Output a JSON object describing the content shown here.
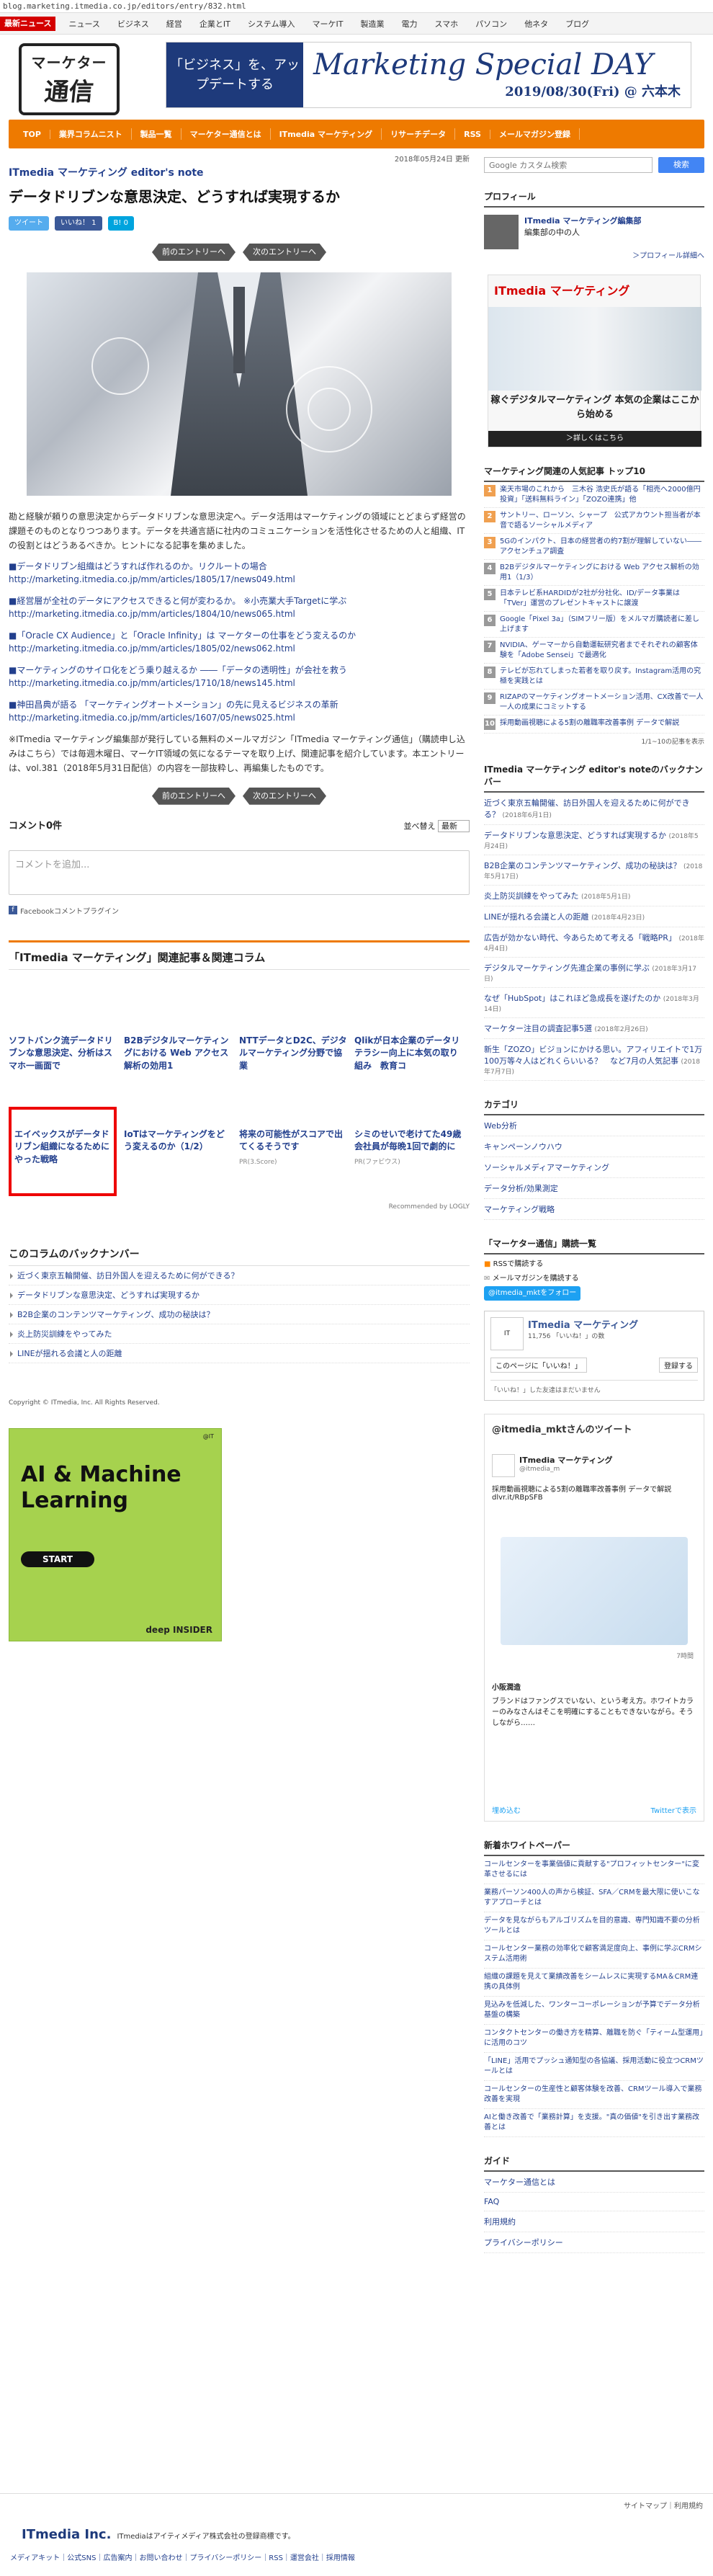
{
  "url": "blog.marketing.itmedia.co.jp/editors/entry/832.html",
  "topnav": {
    "brand": "最新ニュース",
    "items": [
      "ニュース",
      "ビジネス",
      "経営",
      "企業とIT",
      "システム導入",
      "マーケIT",
      "製造業",
      "電力",
      "スマホ",
      "パソコン",
      "他ネタ",
      "ブログ"
    ]
  },
  "logo": {
    "l1": "マーケター",
    "l2": "通信"
  },
  "banner": {
    "left": "「ビジネス」を、アップデートする",
    "title": "Marketing Special DAY",
    "date": "2019/08/30(Fri) @ 六本木"
  },
  "orange_nav": [
    "TOP",
    "業界コラムニスト",
    "製品一覧",
    "マーケター通信とは",
    "ITmedia マーケティング",
    "リサーチデータ",
    "RSS",
    "メールマガジン登録"
  ],
  "article": {
    "date": "2018年05月24日 更新",
    "blog": "ITmedia マーケティング editor's note",
    "title": "データドリブンな意思決定、どうすれば実現するか",
    "share": {
      "tweet": "ツイート",
      "like": "いいね！ 1",
      "hatena": "B! 0"
    },
    "prev": "前のエントリーへ",
    "next": "次のエントリーへ",
    "intro": "勘と経験が頼りの意思決定からデータドリブンな意思決定へ。データ活用はマーケティングの領域にとどまらず経営の課題そのものとなりつつあります。データを共通言語に社内のコミュニケーションを活性化させるための人と組織、ITの役割とはどうあるべきか。ヒントになる記事を集めました。",
    "links": [
      {
        "label": "■データドリブン組織はどうすれば作れるのか。リクルートの場合",
        "url": "http://marketing.itmedia.co.jp/mm/articles/1805/17/news049.html"
      },
      {
        "label": "■経営層が全社のデータにアクセスできると何が変わるか。 ※小売業大手Targetに学ぶ",
        "url": "http://marketing.itmedia.co.jp/mm/articles/1804/10/news065.html"
      },
      {
        "label": "■「Oracle CX Audience」と「Oracle Infinity」は マーケターの仕事をどう変えるのか",
        "url": "http://marketing.itmedia.co.jp/mm/articles/1805/02/news062.html"
      },
      {
        "label": "■マーケティングのサイロ化をどう乗り越えるか ――「データの透明性」が会社を救う",
        "url": "http://marketing.itmedia.co.jp/mm/articles/1710/18/news145.html"
      },
      {
        "label": "■神田昌典が語る 「マーケティングオートメーション」の先に見えるビジネスの革新",
        "url": "http://marketing.itmedia.co.jp/mm/articles/1607/05/news025.html"
      }
    ],
    "note": "※ITmedia マーケティング編集部が発行している無料のメールマガジン「ITmedia マーケティング通信」（購読申し込みはこちら）では毎週木曜日、マーケIT領域の気になるテーマを取り上げ、関連記事を紹介しています。本エントリーは、vol.381（2018年5月31日配信）の内容を一部抜粋し、再編集したものです。"
  },
  "comments": {
    "count": "コメント0件",
    "sort_label": "並べ替え",
    "sort": "最新",
    "placeholder": "コメントを追加...",
    "plugin": "Facebookコメントプラグイン"
  },
  "related": {
    "heading": "「ITmedia マーケティング」関連記事＆関連コラム",
    "items": [
      "ソフトバンク流データドリブンな意思決定、分析はスマホ一画面で",
      "B2Bデジタルマーケティングにおける Web アクセス解析の効用1",
      "NTTデータとD2C、デジタルマーケティング分野で協業",
      "Qlikが日本企業のデータリテラシー向上に本気の取り組み　教育コ"
    ],
    "items2": [
      {
        "title": "エイベックスがデータドリブン組織になるためにやった戦略",
        "pr": ""
      },
      {
        "title": "IoTはマーケティングをどう変えるのか（1/2）",
        "pr": ""
      },
      {
        "title": "将来の可能性がスコアで出てくるそうです",
        "pr": "PR(3.Score)"
      },
      {
        "title": "シミのせいで老けてた49歳会社員が毎晩1回で劇的に",
        "pr": "PR(ファビウス)"
      }
    ],
    "recommended": "Recommended by LOGLY"
  },
  "backnumber": {
    "heading": "このコラムのバックナンバー",
    "items": [
      "近づく東京五輪開催、訪日外国人を迎えるために何ができる？",
      "データドリブンな意思決定、どうすれば実現するか",
      "B2B企業のコンテンツマーケティング、成功の秘訣は？",
      "炎上防災訓練をやってみた",
      "LINEが揺れる会議と人の距離"
    ]
  },
  "copyright": "Copyright © ITmedia, Inc. All Rights Reserved.",
  "left_ad": {
    "title": "AI & Machine Learning",
    "start": "START",
    "brand": "deep INSIDER",
    "qr": "@IT"
  },
  "side": {
    "search_placeholder": "Google カスタム検索",
    "search_btn": "検索",
    "profile_h": "プロフィール",
    "profile_name": "ITmedia マーケティング編集部",
    "profile_desc": "編集部の中の人",
    "profile_more": "＞プロフィール詳細へ",
    "ad": {
      "brand": "ITmedia マーケティング",
      "tagline": "稼ぐデジタルマーケティング 本気の企業はここから始める",
      "more": "＞詳しくはこちら"
    },
    "rank_h": "マーケティング関連の人気記事 トップ10",
    "rank": [
      "楽天市場のこれから　三木谷 浩史氏が語る「相売へ2000億円投資」「送料無料ライン」「ZOZO連携」他",
      "サントリー、ローソン、シャープ　公式アカウント担当者が本音で語るソーシャルメディア",
      "5Gのインパクト、日本の経営者の約7割が理解していない――アクセンチュア調査",
      "B2Bデジタルマーケティングにおける Web アクセス解析の効用1（1/3）",
      "日本テレビ系HARDIDが2社が分社化、ID/データ事業は「TVer」運営のプレゼントキャストに譲渡",
      "Google「Pixel 3a」（SIMフリー版）をメルマガ購読者に差し上げます",
      "NVIDIA、ゲーマーから自動運転研究者までそれぞれの顧客体験を「Adobe Sensei」で最適化",
      "テレビが忘れてしまった若者を取り戻す。Instagram活用の究極を実践とは",
      "RIZAPのマーケティングオートメーション活用、CX改善で一人一人の成果にコミットする",
      "採用動画視聴による5割の離職率改善事例 データで解説"
    ],
    "rank_more": "1/1~10の記事を表示",
    "bn_h": "ITmedia マーケティング editor's noteのバックナンバー",
    "bn": [
      {
        "t": "近づく東京五輪開催、訪日外国人を迎えるために何ができる？",
        "d": "(2018年6月1日)"
      },
      {
        "t": "データドリブンな意思決定、どうすれば実現するか",
        "d": "(2018年5月24日)"
      },
      {
        "t": "B2B企業のコンテンツマーケティング、成功の秘訣は？",
        "d": "(2018年5月17日)"
      },
      {
        "t": "炎上防災訓練をやってみた",
        "d": "(2018年5月1日)"
      },
      {
        "t": "LINEが揺れる会議と人の距離",
        "d": "(2018年4月23日)"
      },
      {
        "t": "広告が効かない時代、今あらためて考える「戦略PR」",
        "d": "(2018年4月4日)"
      },
      {
        "t": "デジタルマーケティング先進企業の事例に学ぶ",
        "d": "(2018年3月17日)"
      },
      {
        "t": "なぜ「HubSpot」はこれほど急成長を遂げたのか",
        "d": "(2018年3月14日)"
      },
      {
        "t": "マーケター注目の調査記事5選",
        "d": "(2018年2月26日)"
      },
      {
        "t": "新生「ZOZO」ビジョンにかける思い。アフィリエイトで1万100万等々人はどれくらいいる？　など7月の人気記事",
        "d": "(2018年7月7日)"
      }
    ],
    "cat_h": "カテゴリ",
    "cats": [
      "Web分析",
      "キャンペーンノウハウ",
      "ソーシャルメディアマーケティング",
      "データ分析/効果測定",
      "マーケティング戦略"
    ],
    "sub_h": "「マーケター通信」購読一覧",
    "subs": [
      "RSSで購読する",
      "メールマガジンを購読する",
      "@itmedia_mktをフォロー"
    ],
    "fb": {
      "name": "ITmedia マーケティング",
      "likes": "11,756 「いいね！」の数",
      "like": "このページに「いいね！」",
      "reg": "登録する",
      "note": "「いいね！」した友達はまだいません"
    },
    "tw": {
      "head": "@itmedia_mktさんのツイート",
      "name": "ITmedia マーケティング",
      "handle": "@itmedia_m",
      "text": "採用動画視聴による5割の離職率改善事例 データで解説 dlvr.it/RBpSFB",
      "time": "7時間",
      "reply_name": "小阪潤造",
      "reply": "ブランドはファングスでいない、という考え方。ホワイトカラーのみなさんはそこを明確にすることもできないながら。そうしながら……",
      "embed": "埋め込む",
      "view": "Twitterで表示"
    },
    "wp_h": "新着ホワイトペーパー",
    "wp": [
      "コールセンターを事業価値に貢献する\"プロフィットセンター\"に変革させるには",
      "業務パーソン400人の声から検証、SFA／CRMを最大限に使いこなすアプローチとは",
      "データを見ながらもアルゴリズムを目的意識、専門知識不要の分析ツールとは",
      "コールセンター業務の効率化で顧客満足度向上、事例に学ぶCRMシステム活用術",
      "組織の課題を見えて業績改善をシームレスに実現するMA＆CRM連携の具体例",
      "見込みを低減した、ワンターコーポレーションが予算でデータ分析基盤の構築",
      "コンタクトセンターの働き方を精算、離職を防ぐ「ティーム型運用」に活用のコツ",
      "「LINE」活用でプッシュ通知型の各協議、採用活動に役立つCRMツールとは",
      "コールセンターの生産性と顧客体験を改善、CRMツール導入で業務改善を実現",
      "AIと働き改善で「業務計算」を支援。\"真の価値\"を引き出す業務改善とは"
    ],
    "guide_h": "ガイド",
    "guide": [
      "マーケター通信とは",
      "FAQ",
      "利用規約",
      "プライバシーポリシー"
    ]
  },
  "footer": {
    "sitemap": "サイトマップ｜利用規約",
    "brand": "ITmedia Inc.",
    "tag": "ITmediaはアイティメディア株式会社の登録商標です。",
    "links": "メディアキット｜公式SNS｜広告案内｜お問い合わせ｜プライバシーポリシー｜RSS｜運営会社｜採用情報"
  },
  "colors": {
    "accent": "#ee7a00",
    "brand_red": "#d40000",
    "link": "#223f8d"
  }
}
